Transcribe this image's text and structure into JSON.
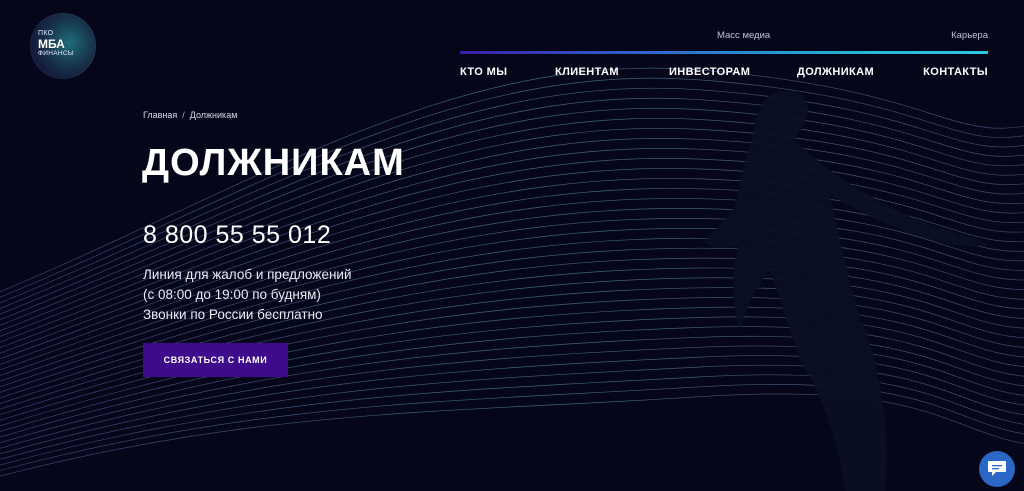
{
  "logo": {
    "line1": "ПКО",
    "line2": "МБА",
    "line3": "ФИНАНСЫ"
  },
  "top_links": {
    "media": "Масс медиа",
    "career": "Карьера"
  },
  "nav": {
    "items": [
      "КТО МЫ",
      "КЛИЕНТАМ",
      "ИНВЕСТОРАМ",
      "ДОЛЖНИКАМ",
      "КОНТАКТЫ"
    ]
  },
  "breadcrumb": {
    "home": "Главная",
    "separator": "/",
    "current": "Должникам"
  },
  "hero": {
    "title": "ДОЛЖНИКАМ",
    "phone": "8 800 55 55 012",
    "lines": [
      "Линия для жалоб и предложений",
      "(с 08:00 до 19:00 по будням)",
      "Звонки по России бесплатно"
    ],
    "cta_label": "СВЯЗАТЬСЯ С НАМИ"
  },
  "colors": {
    "background": "#06061a",
    "cta": "#3d0b8c",
    "nav_gradient_start": "#3b1fa6",
    "nav_gradient_end": "#2cc8e0",
    "chat_button": "#2b67c4"
  },
  "icons": {
    "chat": "chat-bubble-icon"
  }
}
